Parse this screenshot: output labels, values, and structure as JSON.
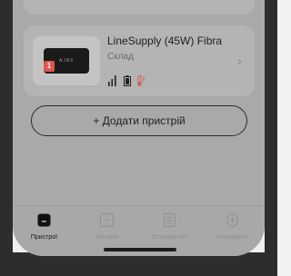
{
  "device_card": {
    "name": "LineSupply (45W) Fibra",
    "room": "Склад",
    "alert_count": "1",
    "thumb_text": "AJAX"
  },
  "add_device": {
    "label": "+ Додати пристрій"
  },
  "tabbar": {
    "items": [
      {
        "label": "Пристрої",
        "icon": "devices-icon",
        "active": true
      },
      {
        "label": "Кімнати",
        "icon": "rooms-icon",
        "active": false
      },
      {
        "label": "Сповіщення",
        "icon": "notifications-icon",
        "active": false
      },
      {
        "label": "Керування",
        "icon": "control-icon",
        "active": false
      }
    ]
  },
  "colors": {
    "alert": "#e0554e",
    "thermometer_alert": "#d05a55"
  }
}
